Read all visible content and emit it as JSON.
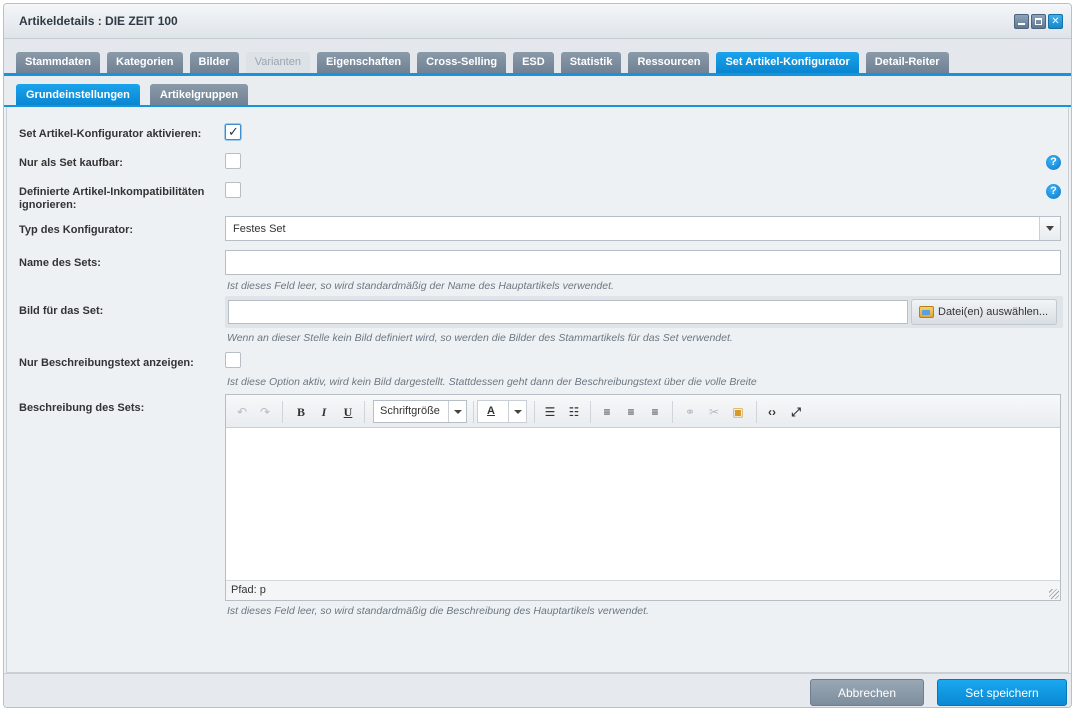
{
  "window": {
    "title": "Artikeldetails : DIE ZEIT 100"
  },
  "tabs": [
    {
      "label": "Stammdaten",
      "state": "normal"
    },
    {
      "label": "Kategorien",
      "state": "normal"
    },
    {
      "label": "Bilder",
      "state": "normal"
    },
    {
      "label": "Varianten",
      "state": "disabled"
    },
    {
      "label": "Eigenschaften",
      "state": "normal"
    },
    {
      "label": "Cross-Selling",
      "state": "normal"
    },
    {
      "label": "ESD",
      "state": "normal"
    },
    {
      "label": "Statistik",
      "state": "normal"
    },
    {
      "label": "Ressourcen",
      "state": "normal"
    },
    {
      "label": "Set Artikel-Konfigurator",
      "state": "active"
    },
    {
      "label": "Detail-Reiter",
      "state": "normal"
    }
  ],
  "subtabs": [
    {
      "label": "Grundeinstellungen",
      "state": "active"
    },
    {
      "label": "Artikelgruppen",
      "state": "normal"
    }
  ],
  "form": {
    "activate_label": "Set Artikel-Konfigurator aktivieren:",
    "activate_checked": true,
    "only_set_label": "Nur als Set kaufbar:",
    "incompat_label_1": "Definierte Artikel-Inkompatibilitäten",
    "incompat_label_2": "ignorieren:",
    "type_label": "Typ des Konfigurator:",
    "type_value": "Festes Set",
    "name_label": "Name des Sets:",
    "name_value": "",
    "name_hint": "Ist dieses Feld leer, so wird standardmäßig der Name des Hauptartikels verwendet.",
    "image_label": "Bild für das Set:",
    "image_value": "",
    "image_button": "Datei(en) auswählen...",
    "image_hint": "Wenn an dieser Stelle kein Bild definiert wird, so werden die Bilder des Stammartikels für das Set verwendet.",
    "desc_only_label": "Nur Beschreibungstext anzeigen:",
    "desc_only_hint": "Ist diese Option aktiv, wird kein Bild dargestellt. Stattdessen geht dann der Beschreibungstext über die volle Breite",
    "desc_label": "Beschreibung des Sets:",
    "desc_hint": "Ist dieses Feld leer, so wird standardmäßig die Beschreibung des Hauptartikels verwendet.",
    "help_glyph": "?"
  },
  "editor": {
    "bold": "B",
    "italic": "I",
    "underline": "U",
    "font_size_label": "Schriftgröße",
    "font_color_label": "A",
    "status_path": "Pfad: p"
  },
  "footer": {
    "cancel_label": "Abbrechen",
    "save_label": "Set speichern"
  },
  "colors": {
    "accent": "#1593dc",
    "tab_inactive": "#7d8d9d"
  }
}
